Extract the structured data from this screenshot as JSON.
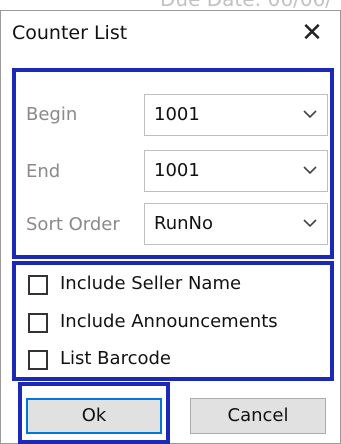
{
  "background_text": "Due Date: 06/06/",
  "dialog": {
    "title": "Counter List",
    "close_glyph": "✕"
  },
  "fields": {
    "begin": {
      "label": "Begin",
      "value": "1001",
      "icon": "chevron-down-icon"
    },
    "end": {
      "label": "End",
      "value": "1001",
      "icon": "chevron-down-icon"
    },
    "sort_order": {
      "label": "Sort Order",
      "value": "RunNo",
      "icon": "chevron-down-icon"
    }
  },
  "options": {
    "include_seller_name": {
      "label": "Include Seller Name",
      "checked": false
    },
    "include_announcements": {
      "label": "Include Announcements",
      "checked": false
    },
    "list_barcode": {
      "label": "List Barcode",
      "checked": false
    }
  },
  "buttons": {
    "ok": "Ok",
    "cancel": "Cancel"
  },
  "colors": {
    "highlight_outline": "#1c28b8",
    "focus_outline": "#0078d7",
    "button_face": "#e1e1e1",
    "disabled_label": "#8a8a8a"
  }
}
